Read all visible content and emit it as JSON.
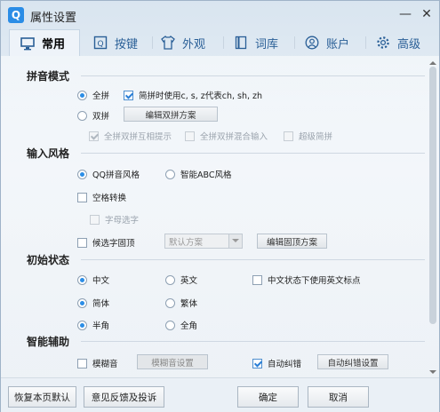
{
  "window": {
    "title": "属性设置",
    "logo_letter": "Q",
    "minimize": "—",
    "close": "✕"
  },
  "tabs": [
    {
      "label": "常用",
      "icon": "monitor-icon"
    },
    {
      "label": "按键",
      "icon": "keyboard-icon"
    },
    {
      "label": "外观",
      "icon": "shirt-icon"
    },
    {
      "label": "词库",
      "icon": "book-icon"
    },
    {
      "label": "账户",
      "icon": "user-icon"
    },
    {
      "label": "高级",
      "icon": "gear-icon"
    }
  ],
  "pinyin_mode": {
    "title": "拼音模式",
    "full_label": "全拼",
    "simplified_label": "简拼时使用c, s, z代表ch, sh, zh",
    "double_label": "双拼",
    "edit_double_button": "编辑双拼方案",
    "mutual_hint_label": "全拼双拼互相提示",
    "mixed_input_label": "全拼双拼混合输入",
    "super_simplified_label": "超级简拼"
  },
  "input_style": {
    "title": "输入风格",
    "qq_style_label": "QQ拼音风格",
    "abc_style_label": "智能ABC风格",
    "space_convert_label": "空格转换",
    "letter_select_label": "字母选字",
    "fixed_top_label": "候选字固顶",
    "scheme_combo_value": "默认方案",
    "edit_fixed_button": "编辑固顶方案"
  },
  "initial_state": {
    "title": "初始状态",
    "chinese_label": "中文",
    "english_label": "英文",
    "english_punct_label": "中文状态下使用英文标点",
    "simplified_label": "简体",
    "traditional_label": "繁体",
    "half_width_label": "半角",
    "full_width_label": "全角"
  },
  "smart_assist": {
    "title": "智能辅助",
    "fuzzy_label": "模糊音",
    "fuzzy_settings_button": "模糊音设置",
    "autocorrect_label": "自动纠错",
    "autocorrect_settings_button": "自动纠错设置"
  },
  "footer": {
    "restore_button": "恢复本页默认",
    "feedback_button": "意见反馈及投诉",
    "ok_button": "确定",
    "cancel_button": "取消"
  },
  "colors": {
    "accent": "#2b8de6",
    "tab_text": "#2a5f97"
  }
}
